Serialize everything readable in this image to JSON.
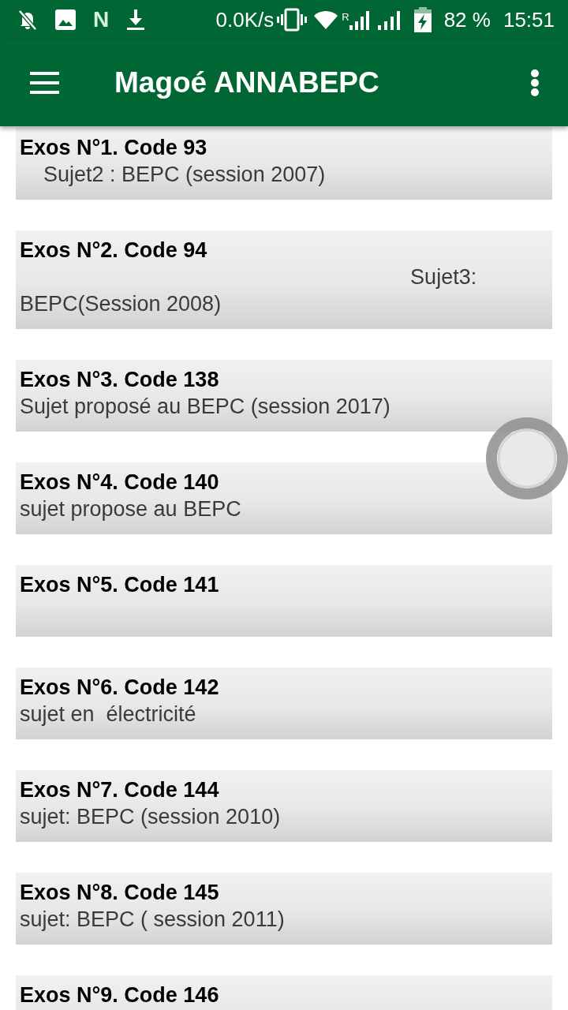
{
  "status_bar": {
    "app_icon_letter": "N",
    "network_speed": "0.0K/s",
    "roaming": "R",
    "battery_percent": "82 %",
    "time": "15:51"
  },
  "app_bar": {
    "title": "Magoé ANNABEPC"
  },
  "exercises": [
    {
      "title": "Exos N°1. Code 93",
      "subtitle": "    Sujet2 : BEPC (session 2007)"
    },
    {
      "title": "Exos N°2. Code 94",
      "subtitle": "                                                                  Sujet3: BEPC(Session 2008)"
    },
    {
      "title": "Exos N°3. Code 138",
      "subtitle": "Sujet proposé au BEPC (session 2017)"
    },
    {
      "title": "Exos N°4. Code 140",
      "subtitle": "sujet propose au BEPC"
    },
    {
      "title": "Exos N°5. Code 141"
    },
    {
      "title": "Exos N°6. Code 142",
      "subtitle": "sujet en  électricité"
    },
    {
      "title": "Exos N°7. Code 144",
      "subtitle": "sujet: BEPC (session 2010)"
    },
    {
      "title": "Exos N°8. Code 145",
      "subtitle": "sujet: BEPC ( session 2011)"
    },
    {
      "title": "Exos N°9. Code 146"
    }
  ]
}
